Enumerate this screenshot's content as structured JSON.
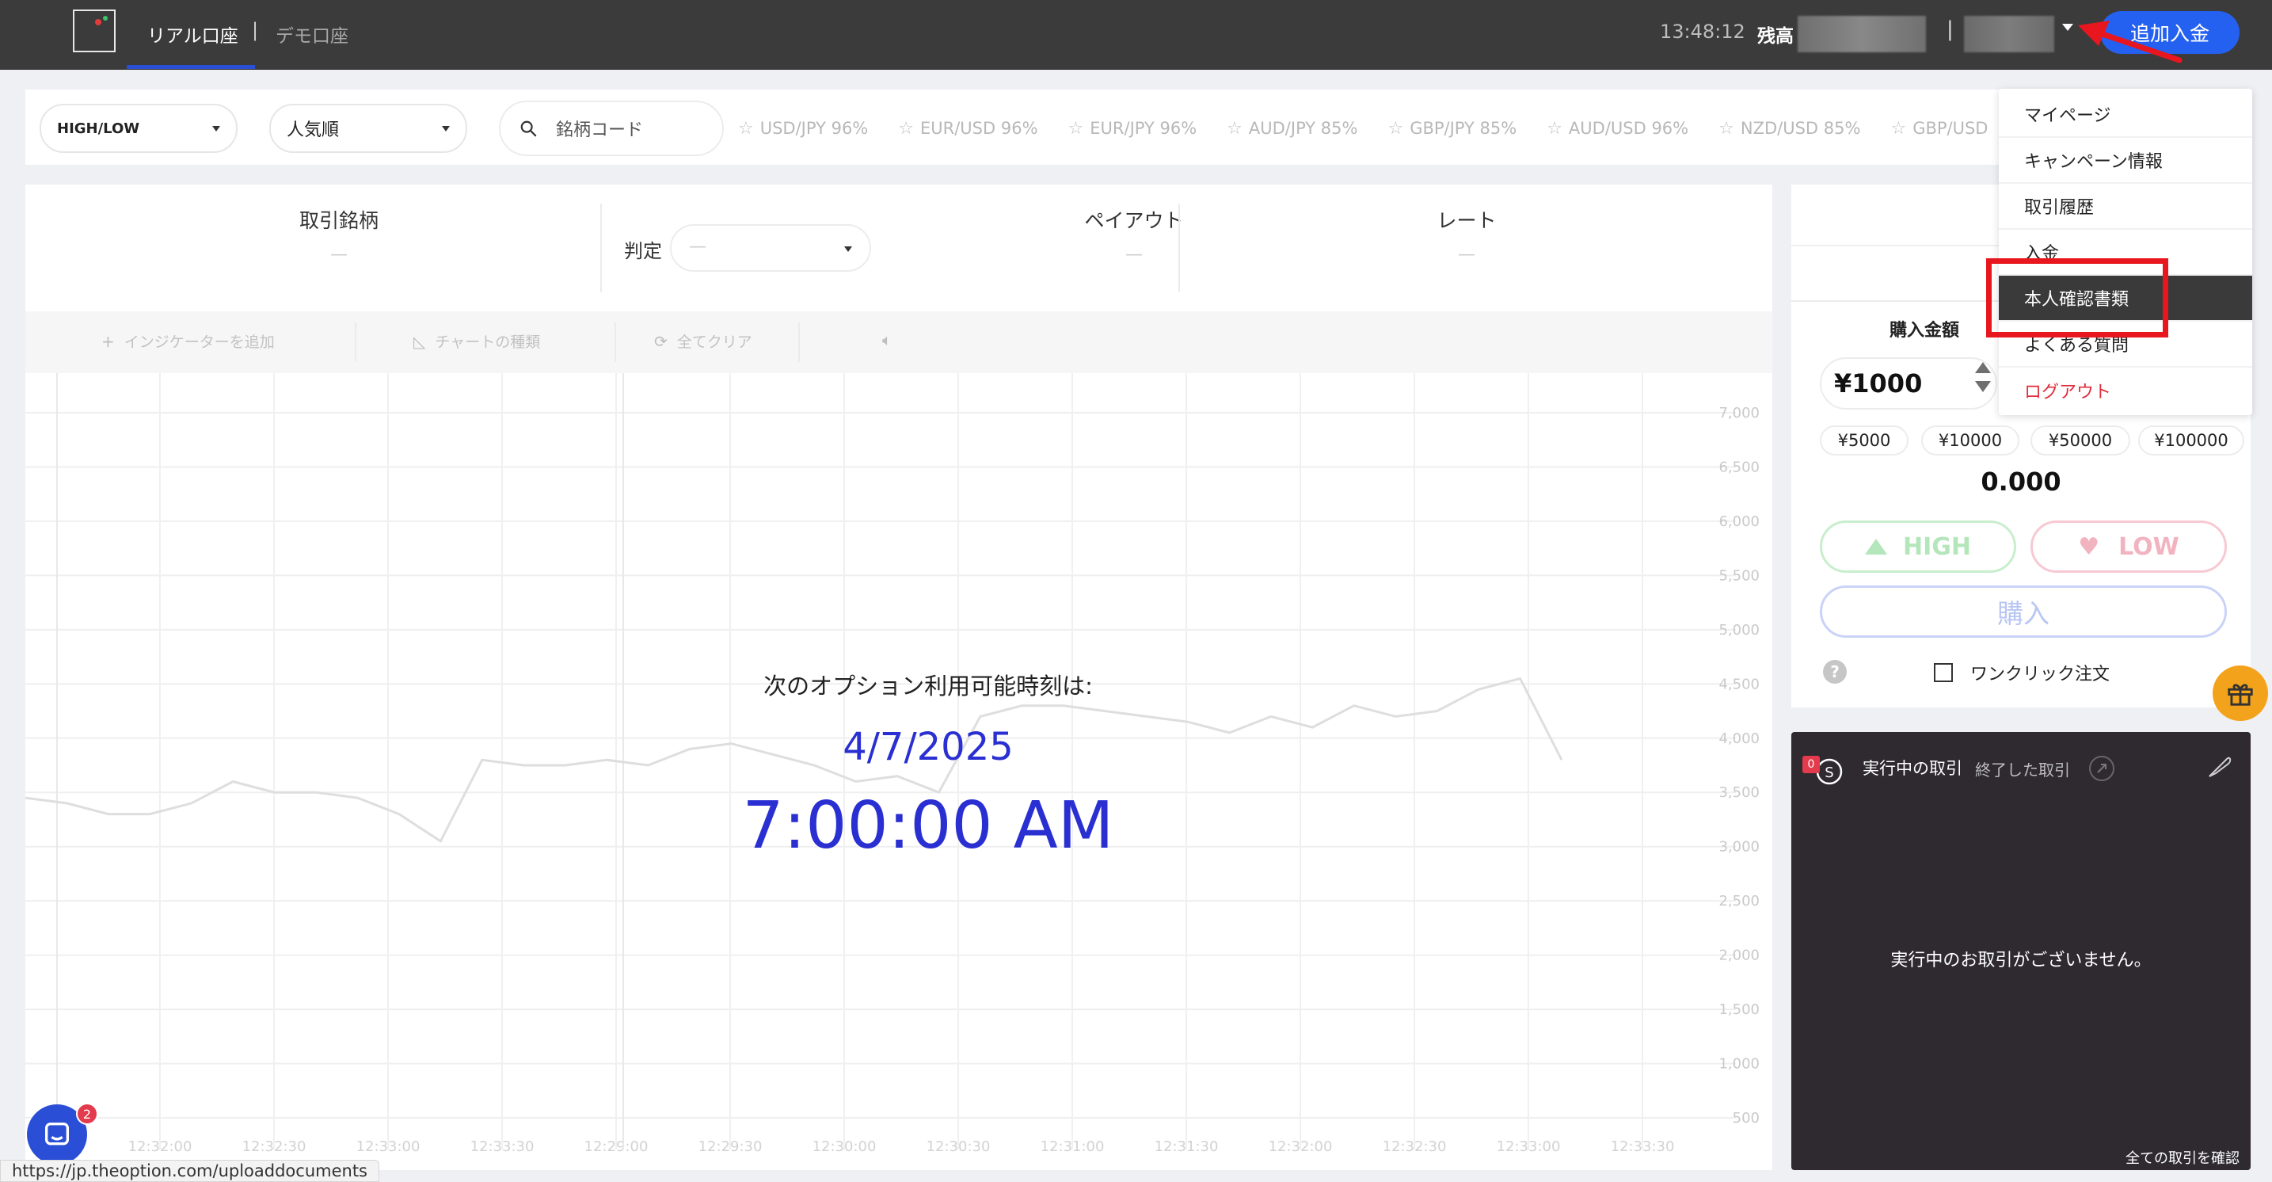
{
  "topbar": {
    "tab_real": "リアル口座",
    "tab_separator": "|",
    "tab_demo": "デモ口座",
    "clock": "13:48:12",
    "balance_label": "残高",
    "separator": "|",
    "deposit_button": "追加入金"
  },
  "filterbar": {
    "trade_type": "HIGH/LOW",
    "sort": "人気順",
    "search_placeholder": "銘柄コード",
    "favorites": [
      {
        "pair": "USD/JPY 96%"
      },
      {
        "pair": "EUR/USD 96%"
      },
      {
        "pair": "EUR/JPY 96%"
      },
      {
        "pair": "AUD/JPY 85%"
      },
      {
        "pair": "GBP/JPY 85%"
      },
      {
        "pair": "AUD/USD 96%"
      },
      {
        "pair": "NZD/USD 85%"
      },
      {
        "pair": "GBP/USD"
      }
    ]
  },
  "info": {
    "symbol_label": "取引銘柄",
    "symbol_value": "—",
    "judge_label": "判定",
    "judge_value": "—",
    "payout_label": "ペイアウト",
    "payout_value": "—",
    "rate_label": "レート",
    "rate_value": "—"
  },
  "toolbar": {
    "add_indicator": "インジケーターを追加",
    "chart_type": "チャートの種類",
    "clear_all": "全てクリア"
  },
  "chart_data": {
    "type": "line",
    "x": [
      "12:32:00",
      "12:32:30",
      "12:33:00",
      "12:33:30",
      "12:29:00",
      "12:29:30",
      "12:30:00",
      "12:30:30",
      "12:31:00",
      "12:31:30",
      "12:32:00",
      "12:32:30",
      "12:33:00",
      "12:33:30"
    ],
    "y_ticks": [
      "7,000",
      "6,500",
      "6,000",
      "5,500",
      "5,000",
      "4,500",
      "4,000",
      "3,500",
      "3,000",
      "2,500",
      "2,000",
      "1,500",
      "1,000",
      "500"
    ],
    "ylim": [
      500,
      7000
    ],
    "grid": true,
    "series": [
      {
        "values": [
          3450,
          3400,
          3300,
          3300,
          3400,
          3600,
          3500,
          3500,
          3450,
          3300,
          3050,
          3800,
          3750,
          3750,
          3800,
          3750,
          3900,
          3950,
          3850,
          3750,
          3600,
          3650,
          3500,
          4200,
          4300,
          4300,
          4250,
          4200,
          4150,
          4050,
          4200,
          4100,
          4300,
          4200,
          4250,
          4450,
          4550,
          3800
        ]
      }
    ]
  },
  "overlay": {
    "next_label": "次のオプション利用可能時刻は:",
    "next_date": "4/7/2025",
    "next_time": "7:00:00 AM"
  },
  "trade_panel": {
    "buy_amount_label": "購入金額",
    "amount_value": "¥1000",
    "presets": [
      "¥5000",
      "¥10000",
      "¥50000",
      "¥100000"
    ],
    "payout_value": "0.000",
    "high_label": "HIGH",
    "low_label": "LOW",
    "buy_label": "購入",
    "help": "?",
    "one_click_label": "ワンクリック注文"
  },
  "trades": {
    "count": "0",
    "tab_active": "実行中の取引",
    "tab_ended": "終了した取引",
    "empty_message": "実行中のお取引がございません。",
    "see_all": "全ての取引を確認"
  },
  "dropdown": {
    "items": [
      "マイページ",
      "キャンペーン情報",
      "取引履歴",
      "入金",
      "本人確認書類",
      "よくある質問",
      "ログアウト"
    ]
  },
  "chat_badge": "2",
  "status_url": "https://jp.theoption.com/uploaddocuments",
  "colors": {
    "accent_blue": "#2561f0",
    "highlight_red": "#e8161e",
    "countdown_blue": "#2a2fd2"
  }
}
